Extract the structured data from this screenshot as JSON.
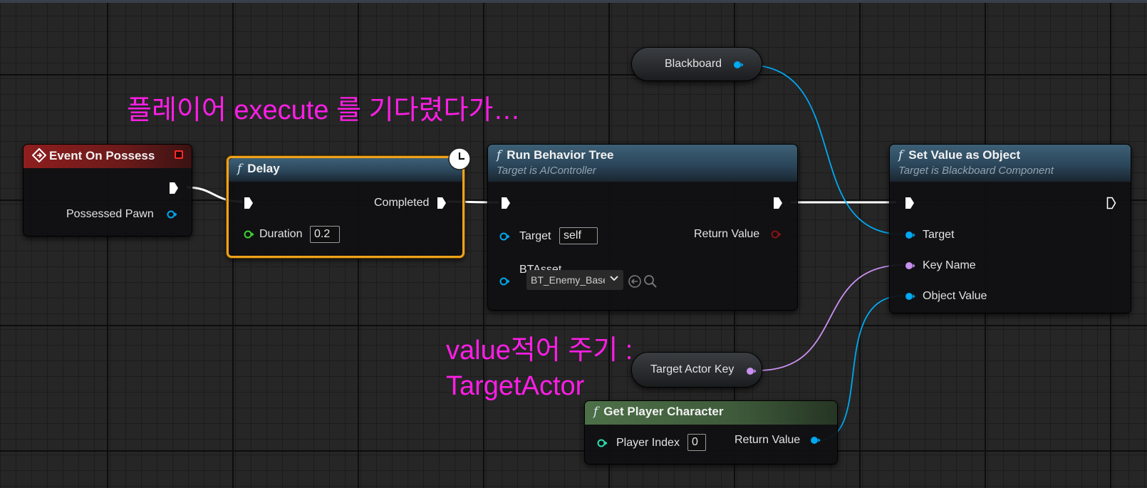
{
  "annotations": {
    "wait_note": "플레이어 execute 를 기다렸다가…",
    "value_note_line1": "value적어 주기 :",
    "value_note_line2": "TargetActor"
  },
  "nodes": {
    "event_on_possess": {
      "title": "Event On Possess",
      "pin_possessed_pawn": "Possessed Pawn"
    },
    "delay": {
      "title": "Delay",
      "pin_completed": "Completed",
      "pin_duration": "Duration",
      "duration_value": "0.2"
    },
    "run_behavior_tree": {
      "title": "Run Behavior Tree",
      "subtitle": "Target is AIController",
      "pin_target": "Target",
      "target_value": "self",
      "pin_return_value": "Return Value",
      "pin_btasset": "BTAsset",
      "btasset_value": "BT_Enemy_Base"
    },
    "set_value_as_object": {
      "title": "Set Value as Object",
      "subtitle": "Target is Blackboard Component",
      "pin_target": "Target",
      "pin_key_name": "Key Name",
      "pin_object_value": "Object Value"
    },
    "blackboard": {
      "label": "Blackboard"
    },
    "target_actor_key": {
      "label": "Target Actor Key"
    },
    "get_player_character": {
      "title": "Get Player Character",
      "pin_player_index": "Player Index",
      "player_index_value": "0",
      "pin_return_value": "Return Value"
    }
  },
  "colors": {
    "exec_wire": "#ffffff",
    "object_pin": "#00a8f0",
    "name_pin": "#c890f0",
    "float_pin": "#3bd62e",
    "selection": "#f0a21b",
    "annotation": "#ff1ee6"
  },
  "icons": [
    "event-diamond-icon",
    "function-f-icon",
    "clock-icon",
    "chevron-down-icon",
    "use-selected-asset-icon",
    "browse-search-icon"
  ]
}
